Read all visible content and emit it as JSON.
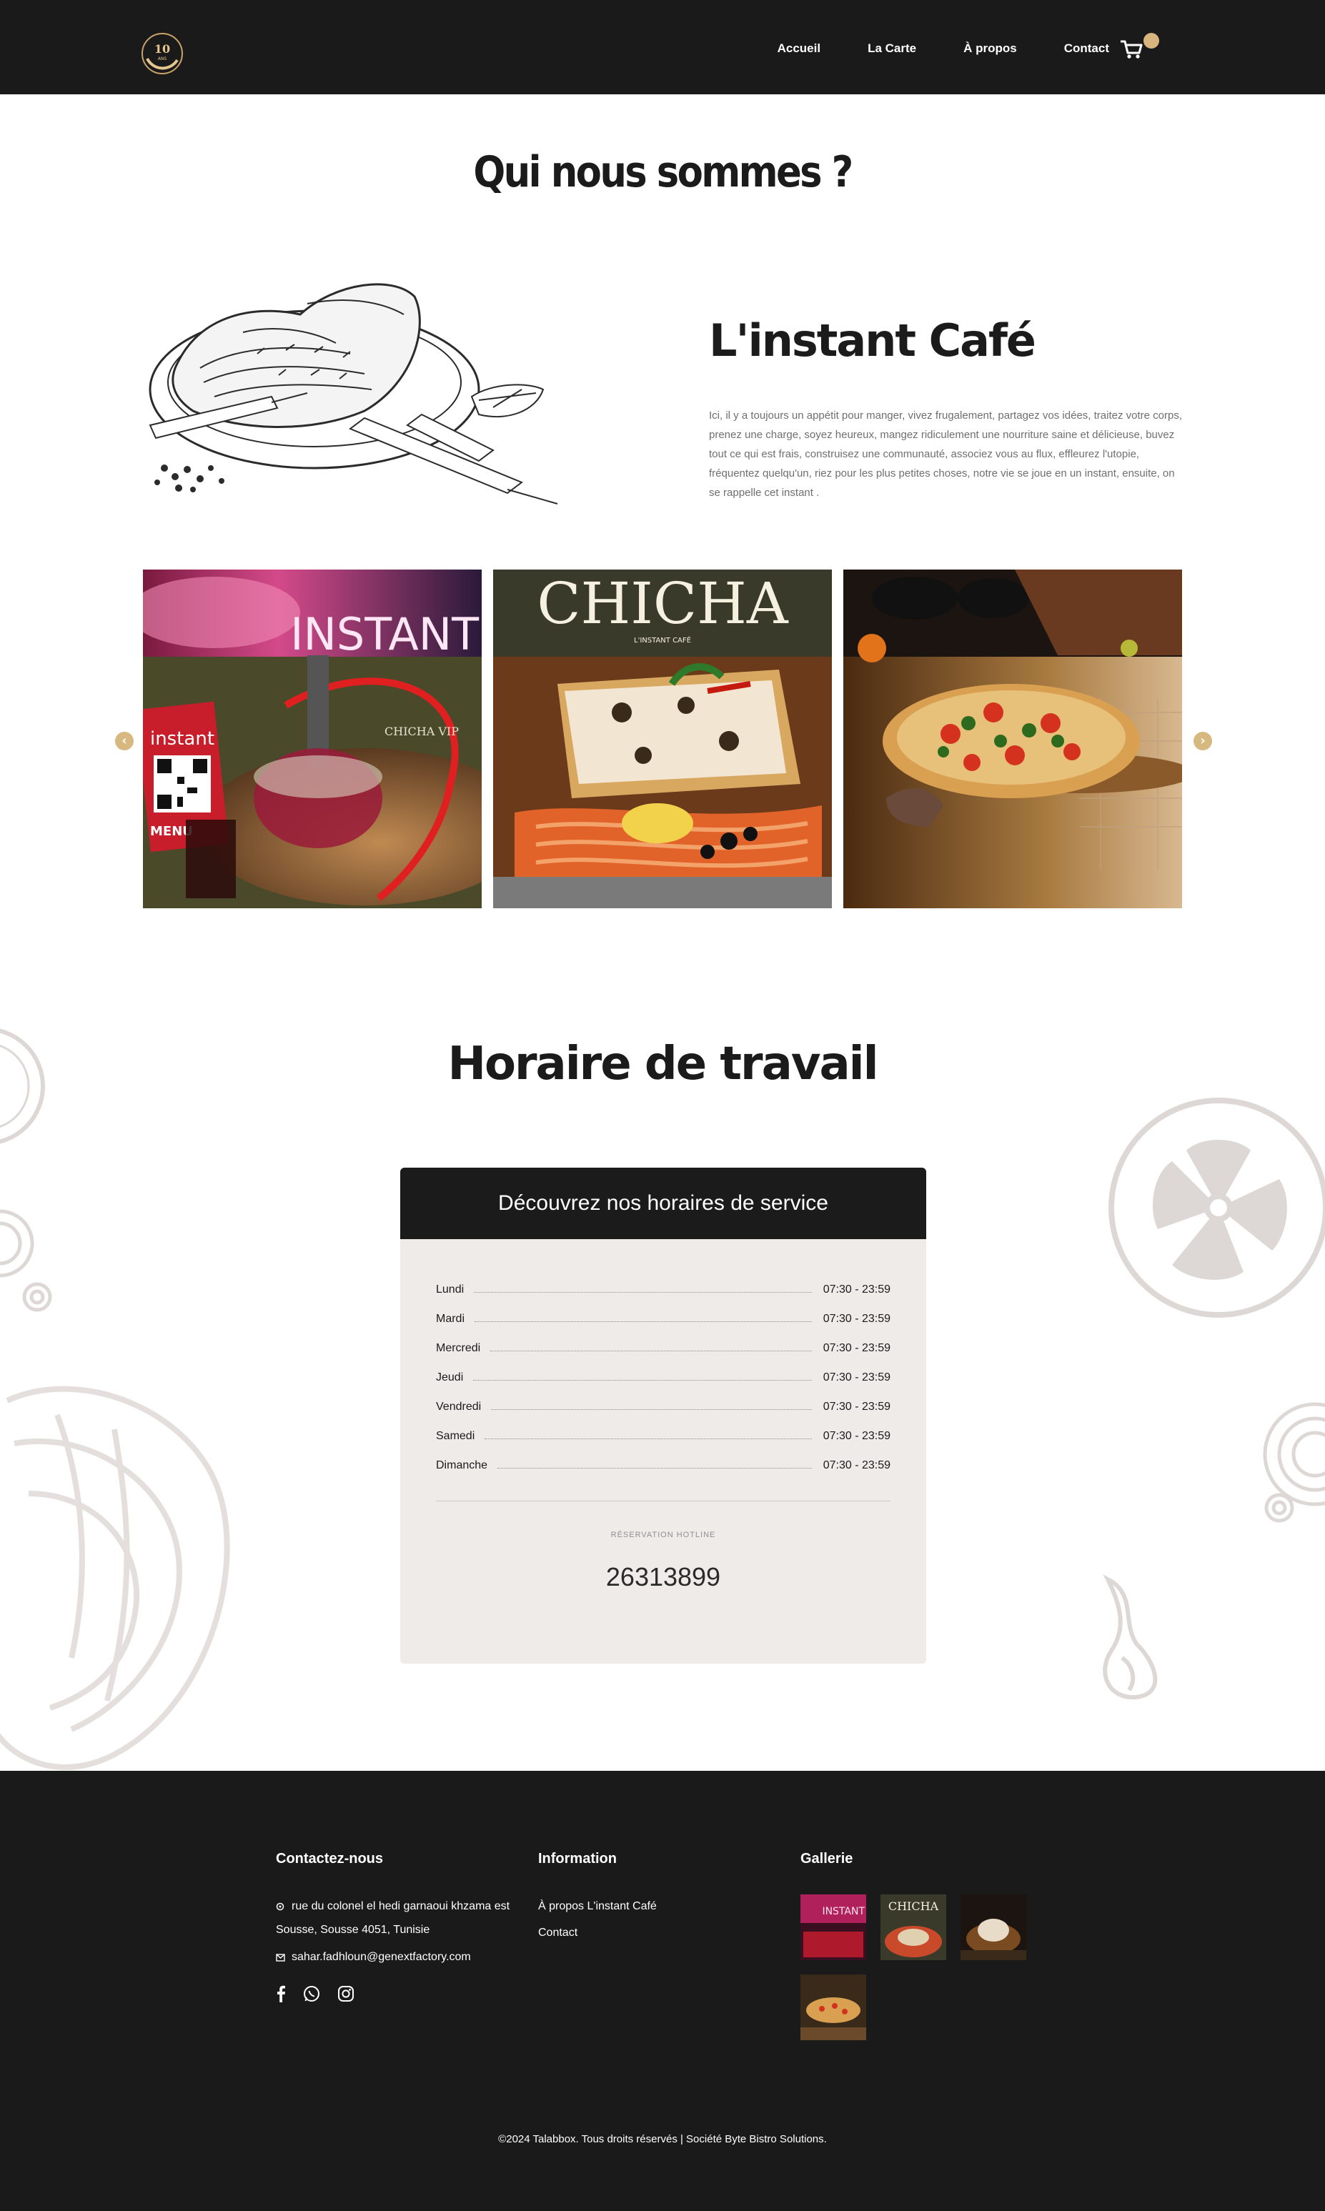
{
  "header": {
    "nav": [
      "Accueil",
      "La Carte",
      "À propos",
      "Contact"
    ],
    "logo_icon": "cafe-logo-10-years",
    "cart_icon": "cart-icon",
    "accent": "#d8b57d"
  },
  "about": {
    "title": "Qui nous sommes ?",
    "cafe_name": "L'instant Café",
    "description": "Ici, il y a toujours un appétit pour manger, vivez frugalement, partagez vos idées, traitez votre corps, prenez une charge, soyez heureux, mangez ridiculement une nourriture saine et délicieuse, buvez tout ce qui est frais, construisez une communauté, associez vous au flux, effleurez l'utopie, fréquentez quelqu'un, riez pour les plus petites choses, notre vie se joue en un instant, ensuite, on se rappelle cet instant ."
  },
  "carousel": {
    "prev_icon": "chevron-left-icon",
    "next_icon": "chevron-right-icon",
    "slides": [
      {
        "sign": "INSTANT",
        "menu_card": "instant",
        "menu_label": "MENU",
        "caption": "CHICHA VIP"
      },
      {
        "title": "CHICHA",
        "subtitle": "L'INSTANT CAFÉ"
      },
      {
        "subject": "pizza"
      }
    ]
  },
  "hours": {
    "title": "Horaire de travail",
    "card_title": "Découvrez nos horaires de service",
    "rows": [
      {
        "day": "Lundi",
        "time": "07:30 - 23:59"
      },
      {
        "day": "Mardi",
        "time": "07:30 - 23:59"
      },
      {
        "day": "Mercredi",
        "time": "07:30 - 23:59"
      },
      {
        "day": "Jeudi",
        "time": "07:30 - 23:59"
      },
      {
        "day": "Vendredi",
        "time": "07:30 - 23:59"
      },
      {
        "day": "Samedi",
        "time": "07:30 - 23:59"
      },
      {
        "day": "Dimanche",
        "time": "07:30 - 23:59"
      }
    ],
    "hotline_label": "RÉSERVATION HOTLINE",
    "hotline_number": "26313899"
  },
  "footer": {
    "contact": {
      "title": "Contactez-nous",
      "address_line1": "rue du colonel el hedi garnaoui khzama est",
      "address_line2": "Sousse, Sousse 4051, Tunisie",
      "email": "sahar.fadhloun@genextfactory.com",
      "location_icon": "location-pin-icon",
      "mail_icon": "mail-icon",
      "social_icons": [
        "facebook-icon",
        "whatsapp-icon",
        "instagram-icon"
      ]
    },
    "information": {
      "title": "Information",
      "links": [
        "À propos L'instant Café",
        "Contact"
      ]
    },
    "gallery": {
      "title": "Gallerie",
      "thumb_sign": "INSTANT",
      "thumb_title": "CHICHA"
    },
    "copyright": "©2024 Talabbox. Tous droits réservés | Société Byte Bistro Solutions."
  }
}
